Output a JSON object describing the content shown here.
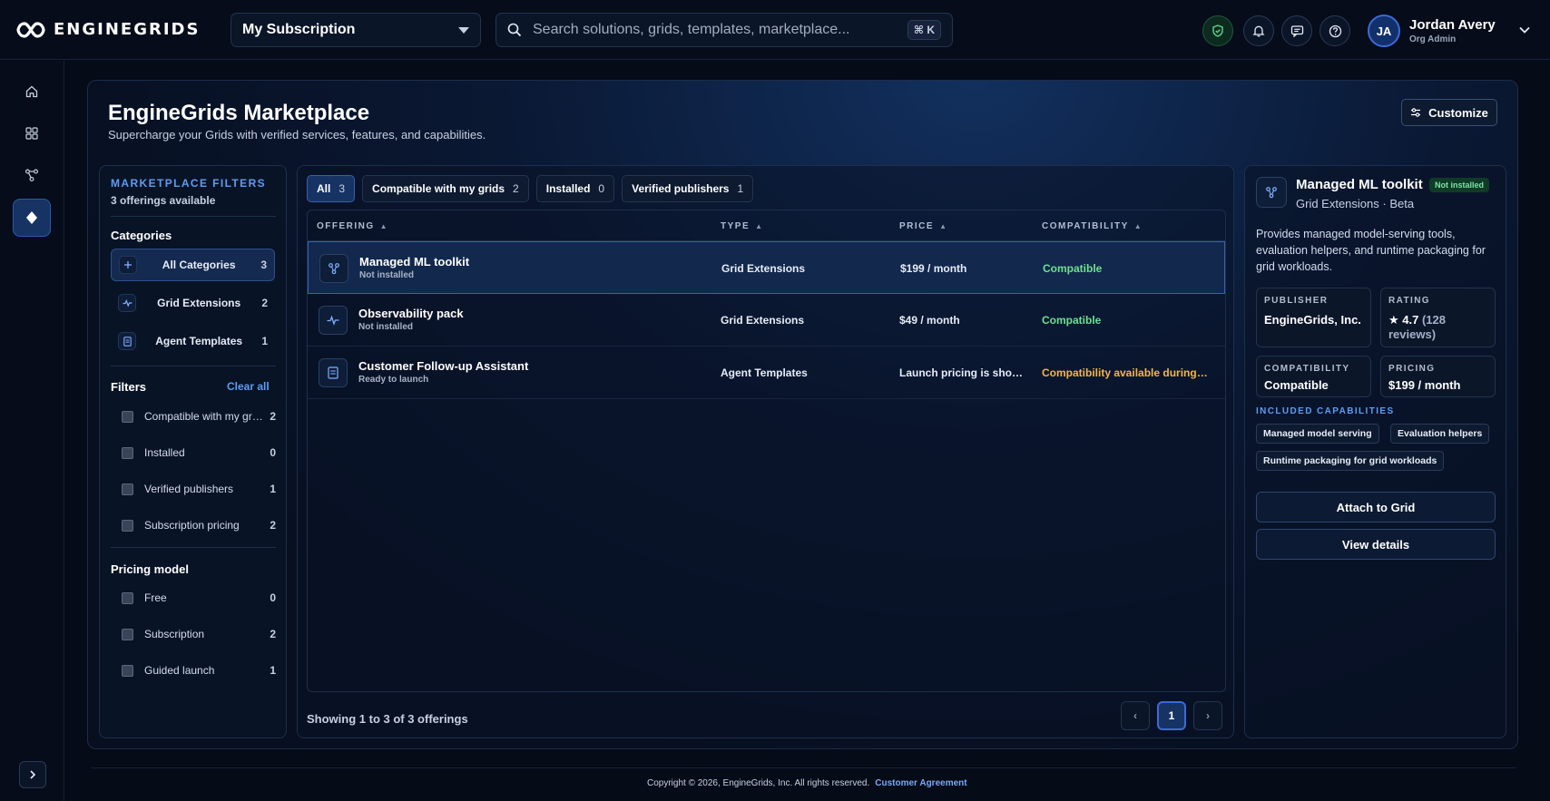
{
  "app": {
    "brand": "ENGINEGRIDS",
    "subscription_select": "My Subscription",
    "search_placeholder": "Search solutions, grids, templates, marketplace...",
    "search_shortcut": "⌘ K",
    "user": {
      "initials": "JA",
      "name": "Jordan Avery",
      "role": "Org Admin"
    }
  },
  "nav": {
    "items": [
      {
        "name": "home-icon",
        "active": false
      },
      {
        "name": "grid-icon",
        "active": false
      },
      {
        "name": "nodes-icon",
        "active": false
      },
      {
        "name": "marketplace-diamond-icon",
        "active": true
      }
    ]
  },
  "page": {
    "title": "EngineGrids Marketplace",
    "subtitle": "Supercharge your Grids with verified services, features, and capabilities.",
    "customize_label": "Customize"
  },
  "filters": {
    "heading": "MARKETPLACE FILTERS",
    "offerings_count": "3 offerings available",
    "categories_label": "Categories",
    "categories": [
      {
        "label": "All Categories",
        "count": "3",
        "icon": "plus-icon",
        "active": true
      },
      {
        "label": "Grid Extensions",
        "count": "2",
        "icon": "pulse-icon",
        "active": false
      },
      {
        "label": "Agent Templates",
        "count": "1",
        "icon": "document-icon",
        "active": false
      }
    ],
    "filters_label": "Filters",
    "clear_all": "Clear all",
    "filter_options": [
      {
        "label": "Compatible with my grids",
        "count": "2"
      },
      {
        "label": "Installed",
        "count": "0"
      },
      {
        "label": "Verified publishers",
        "count": "1"
      },
      {
        "label": "Subscription pricing",
        "count": "2"
      }
    ],
    "pricing_label": "Pricing model",
    "pricing_options": [
      {
        "label": "Free",
        "count": "0"
      },
      {
        "label": "Subscription",
        "count": "2"
      },
      {
        "label": "Guided launch",
        "count": "1"
      }
    ]
  },
  "tabs": [
    {
      "label": "All",
      "count": "3",
      "active": true
    },
    {
      "label": "Compatible with my grids",
      "count": "2",
      "active": false
    },
    {
      "label": "Installed",
      "count": "0",
      "active": false
    },
    {
      "label": "Verified publishers",
      "count": "1",
      "active": false
    }
  ],
  "table": {
    "columns": [
      "OFFERING",
      "TYPE",
      "PRICE",
      "COMPATIBILITY"
    ],
    "rows": [
      {
        "name": "Managed ML toolkit",
        "status": "Not installed",
        "type": "Grid Extensions",
        "price": "$199 / month",
        "compat": "Compatible",
        "compat_color": "#6ee08f",
        "icon": "nodes-icon",
        "selected": true
      },
      {
        "name": "Observability pack",
        "status": "Not installed",
        "type": "Grid Extensions",
        "price": "$49 / month",
        "compat": "Compatible",
        "compat_color": "#6ee08f",
        "icon": "pulse-icon",
        "selected": false
      },
      {
        "name": "Customer Follow-up Assistant",
        "status": "Ready to launch",
        "type": "Agent Templates",
        "price": "Launch pricing is shown during setup",
        "compat": "Compatibility available during setup",
        "compat_color": "#f5b642",
        "icon": "document-icon",
        "selected": false
      }
    ],
    "footer": "Showing 1 to 3 of 3 offerings",
    "page": "1",
    "prev": "‹",
    "next": "›"
  },
  "detail": {
    "title": "Managed ML toolkit",
    "badge": "Not installed",
    "subtitle": "Grid Extensions · Beta",
    "description": "Provides managed model-serving tools, evaluation helpers, and runtime packaging for grid workloads.",
    "publisher_label": "PUBLISHER",
    "publisher": "EngineGrids, Inc.",
    "rating_label": "RATING",
    "rating": "★ 4.7",
    "rating_reviews": "(128 reviews)",
    "compat_label": "COMPATIBILITY",
    "compat": "Compatible",
    "pricing_label": "PRICING",
    "pricing": "$199 / month",
    "caps_label": "INCLUDED CAPABILITIES",
    "caps": [
      "Managed model serving",
      "Evaluation helpers",
      "Runtime packaging for grid workloads"
    ],
    "attach_label": "Attach to Grid",
    "details_label": "View details"
  },
  "footer": {
    "copyright": "Copyright © 2026, EngineGrids, Inc. All rights reserved.",
    "agreement": "Customer Agreement"
  }
}
